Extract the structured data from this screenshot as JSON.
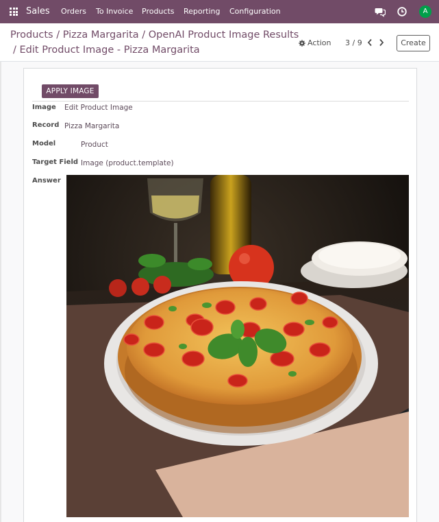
{
  "navbar": {
    "app_name": "Sales",
    "menu": [
      "Orders",
      "To Invoice",
      "Products",
      "Reporting",
      "Configuration"
    ],
    "avatar_initial": "A",
    "icons": [
      "apps-grid-icon",
      "chat-icon",
      "clock-icon"
    ],
    "accent_color": "#714b67"
  },
  "breadcrumb": {
    "items": [
      "Products",
      "Pizza Margarita",
      "OpenAI Product Image Results",
      "Edit Product Image - Pizza Margarita"
    ],
    "separator": "/"
  },
  "control": {
    "action_label": "Action",
    "pager": "3 / 9",
    "create_label": "Create"
  },
  "form": {
    "apply_label": "APPLY IMAGE",
    "fields": [
      {
        "label": "Image",
        "value": "Edit Product Image"
      },
      {
        "label": "Record",
        "value": "Pizza Margarita"
      },
      {
        "label": "Model",
        "value": "Product"
      },
      {
        "label": "Target Field",
        "value": "Image (product.template)"
      }
    ],
    "answer_label": "Answer"
  }
}
